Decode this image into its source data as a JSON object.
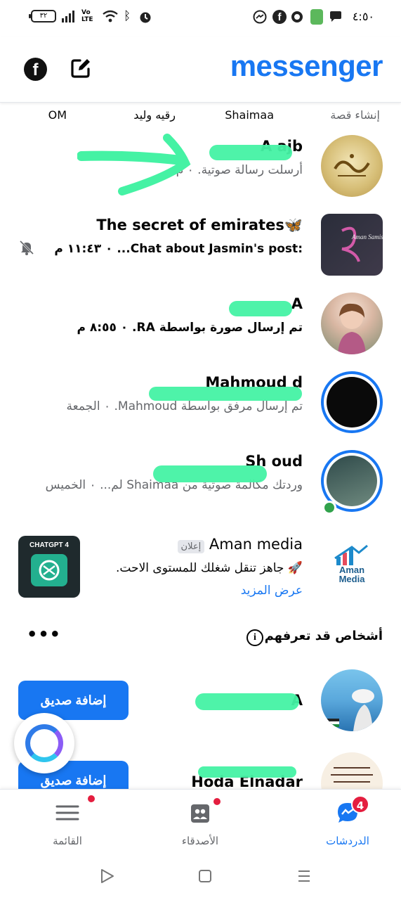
{
  "status_bar": {
    "battery": "٣٢",
    "network": "Vo LTE",
    "time": "٤:٥٠"
  },
  "header": {
    "brand": "messenger",
    "facebook_glyph": "f"
  },
  "stories": {
    "create_label": "إنشاء قصة",
    "names": [
      "Shaimaa",
      "رقيه وليد",
      "OM"
    ]
  },
  "chats": [
    {
      "name": "A   ajb",
      "preview": "أرسلت رسالة صوتية. ٠   م",
      "unread": false,
      "muted": false
    },
    {
      "name": "The secret of emirates",
      "preview": ":Chat about Jasmin's post... ٠ ١١:٤٣ م",
      "unread": true,
      "muted": true
    },
    {
      "name": "A",
      "preview": "تم إرسال صورة بواسطة RA. ٠ ٨:٥٥ م",
      "unread": true,
      "muted": false
    },
    {
      "name": "Mahmoud  d",
      "preview": "تم إرسال مرفق بواسطة Mahmoud. ٠ الجمعة",
      "unread": false,
      "muted": false
    },
    {
      "name": "Sh  oud",
      "preview": "وردتك مكالمة صوتية من Shaimaa لم... ٠ الخميس",
      "unread": false,
      "muted": false
    }
  ],
  "ad": {
    "advertiser": "Aman media",
    "badge": "إعلان",
    "text": "🚀 جاهز تنقل شغلك للمستوى الاحت.",
    "cta": "عرض المزيد",
    "logo_text_1": "Aman",
    "logo_text_2": "Media",
    "thumb_title": "CHATGPT 4"
  },
  "people_you_may_know": {
    "heading": "أشخاص قد تعرفهم",
    "more": "•••",
    "people": [
      {
        "name": "A",
        "button": "إضافة صديق"
      },
      {
        "name": "Hoda Elnadar",
        "button": "إضافة صديق"
      }
    ]
  },
  "bottom_nav": [
    {
      "label": "الدردشات",
      "badge": "4",
      "active": true
    },
    {
      "label": "الأصدقاء",
      "active": false
    },
    {
      "label": "القائمة",
      "active": false
    }
  ],
  "colors": {
    "accent": "#1877f2",
    "notification": "#e41e3f",
    "scribble": "#45f2a4"
  }
}
